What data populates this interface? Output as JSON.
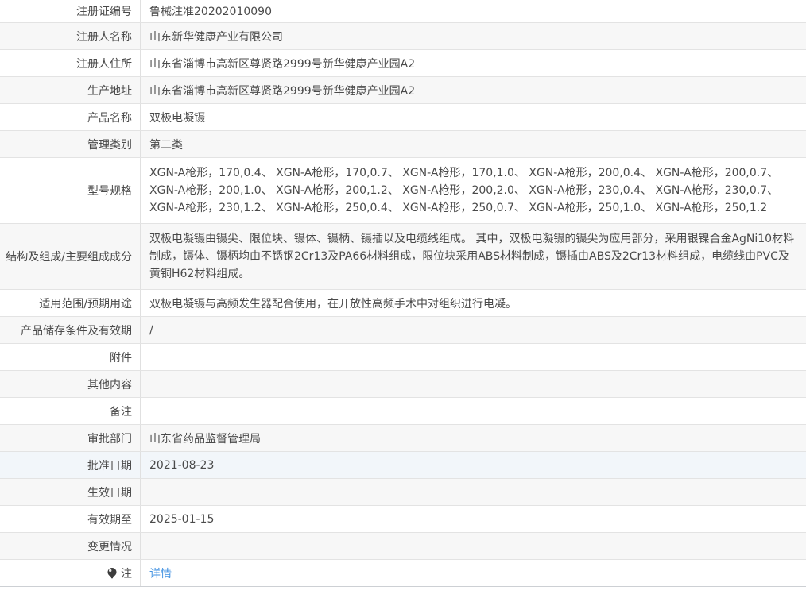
{
  "colors": {
    "link": "#4292e2",
    "row_tint": "#f7f7f7",
    "row_hover": "#f2f6fa",
    "border": "#e3e3e3",
    "text": "#4a4a4a"
  },
  "table": {
    "rows": [
      {
        "label": "注册证编号",
        "value": "鲁械注准20202010090"
      },
      {
        "label": "注册人名称",
        "value": "山东新华健康产业有限公司"
      },
      {
        "label": "注册人住所",
        "value": "山东省淄博市高新区尊贤路2999号新华健康产业园A2"
      },
      {
        "label": "生产地址",
        "value": "山东省淄博市高新区尊贤路2999号新华健康产业园A2"
      },
      {
        "label": "产品名称",
        "value": "双极电凝镊"
      },
      {
        "label": "管理类别",
        "value": "第二类"
      },
      {
        "label": "型号规格",
        "value": "XGN-A枪形，170,0.4、 XGN-A枪形，170,0.7、 XGN-A枪形，170,1.0、 XGN-A枪形，200,0.4、 XGN-A枪形，200,0.7、 XGN-A枪形，200,1.0、 XGN-A枪形，200,1.2、 XGN-A枪形，200,2.0、 XGN-A枪形，230,0.4、 XGN-A枪形，230,0.7、 XGN-A枪形，230,1.2、 XGN-A枪形，250,0.4、 XGN-A枪形，250,0.7、 XGN-A枪形，250,1.0、 XGN-A枪形，250,1.2"
      },
      {
        "label": "结构及组成/主要组成成分",
        "value": "双极电凝镊由镊尖、限位块、镊体、镊柄、镊插以及电缆线组成。 其中，双极电凝镊的镊尖为应用部分，采用银镍合金AgNi10材料制成，镊体、镊柄均由不锈钢2Cr13及PA66材料组成，限位块采用ABS材料制成，镊插由ABS及2Cr13材料组成，电缆线由PVC及黄铜H62材料组成。"
      },
      {
        "label": "适用范围/预期用途",
        "value": "双极电凝镊与高频发生器配合使用，在开放性高频手术中对组织进行电凝。"
      },
      {
        "label": "产品储存条件及有效期",
        "value": "/"
      },
      {
        "label": "附件",
        "value": ""
      },
      {
        "label": "其他内容",
        "value": ""
      },
      {
        "label": "备注",
        "value": ""
      },
      {
        "label": "审批部门",
        "value": "山东省药品监督管理局"
      },
      {
        "label": "批准日期",
        "value": "2021-08-23",
        "hover": true
      },
      {
        "label": "生效日期",
        "value": ""
      },
      {
        "label": "有效期至",
        "value": "2025-01-15"
      },
      {
        "label": "变更情况",
        "value": ""
      },
      {
        "label": "注",
        "value": "详情",
        "link": true,
        "icon": "bulb-icon"
      }
    ]
  }
}
